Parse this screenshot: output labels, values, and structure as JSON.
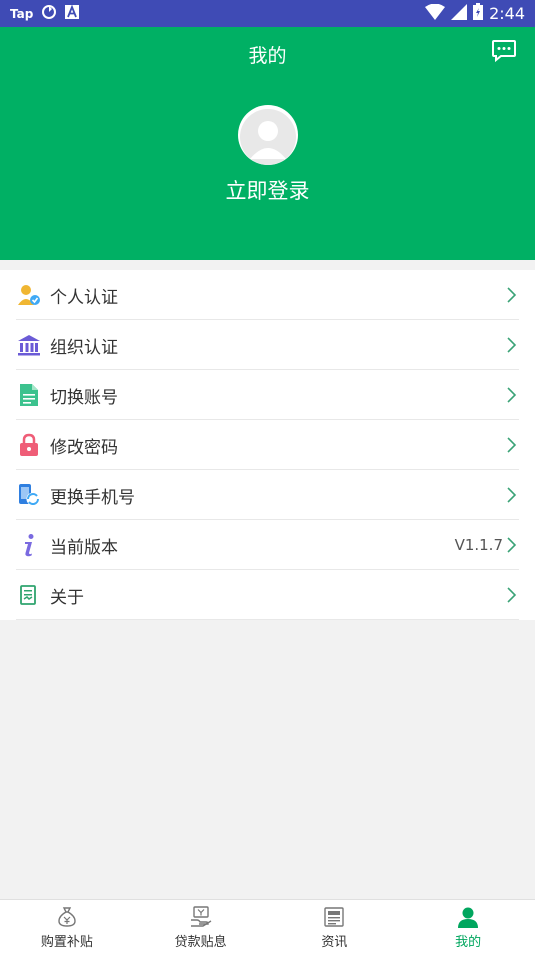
{
  "status_bar": {
    "left_label": "Tap",
    "time": "2:44",
    "background": "#3f4bb5"
  },
  "header": {
    "title": "我的",
    "login_text": "立即登录",
    "background": "#00b064",
    "message_icon": "chat-bubble-icon"
  },
  "menu": {
    "items": [
      {
        "label": "个人认证",
        "icon": "person-verified-icon",
        "value": ""
      },
      {
        "label": "组织认证",
        "icon": "bank-building-icon",
        "value": ""
      },
      {
        "label": "切换账号",
        "icon": "document-icon",
        "value": ""
      },
      {
        "label": "修改密码",
        "icon": "lock-icon",
        "value": ""
      },
      {
        "label": "更换手机号",
        "icon": "phone-refresh-icon",
        "value": ""
      },
      {
        "label": "当前版本",
        "icon": "info-icon",
        "value": "V1.1.7"
      },
      {
        "label": "关于",
        "icon": "about-note-icon",
        "value": ""
      }
    ]
  },
  "tabbar": {
    "tabs": [
      {
        "label": "购置补贴",
        "icon": "money-bag-icon",
        "active": false
      },
      {
        "label": "贷款贴息",
        "icon": "hand-money-icon",
        "active": false
      },
      {
        "label": "资讯",
        "icon": "news-icon",
        "active": false
      },
      {
        "label": "我的",
        "icon": "user-icon",
        "active": true
      }
    ],
    "active_color": "#00a65e"
  }
}
